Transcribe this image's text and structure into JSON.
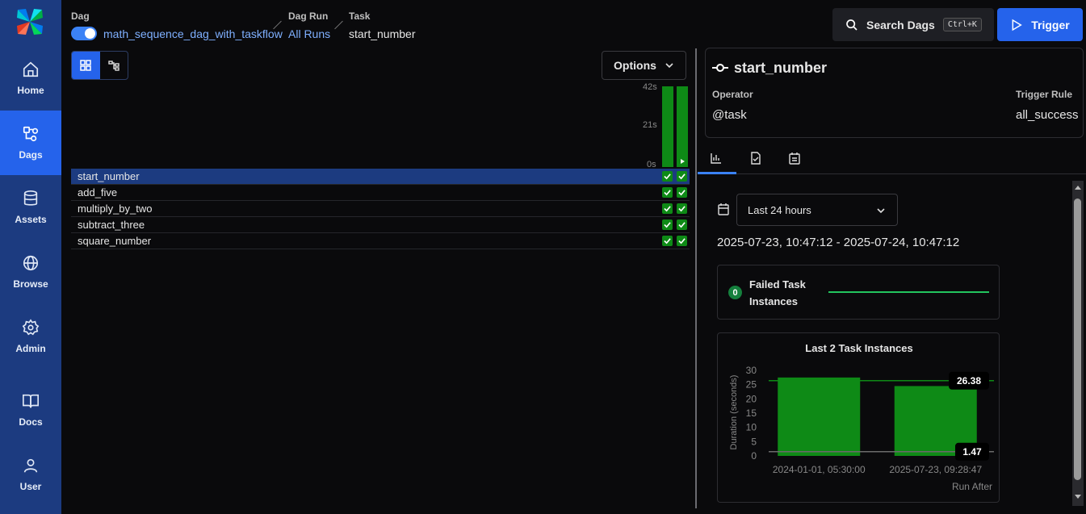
{
  "nav": [
    {
      "label": "Home",
      "icon": "home-icon"
    },
    {
      "label": "Dags",
      "icon": "dags-icon",
      "active": true
    },
    {
      "label": "Assets",
      "icon": "database-icon"
    },
    {
      "label": "Browse",
      "icon": "globe-icon"
    },
    {
      "label": "Admin",
      "icon": "gear-icon"
    },
    {
      "label": "Docs",
      "icon": "book-icon"
    },
    {
      "label": "User",
      "icon": "user-icon"
    }
  ],
  "breadcrumb": {
    "dag_label": "Dag",
    "dag_value": "math_sequence_dag_with_taskflow",
    "run_label": "Dag Run",
    "run_value": "All Runs",
    "task_label": "Task",
    "task_value": "start_number"
  },
  "header": {
    "search_label": "Search Dags",
    "search_shortcut": "Ctrl+K",
    "trigger_label": "Trigger"
  },
  "grid": {
    "options_label": "Options",
    "duration_ticks": [
      "42s",
      "21s",
      "0s"
    ],
    "run_durations_fraction": [
      1.0,
      1.0
    ],
    "tasks": [
      "start_number",
      "add_five",
      "multiply_by_two",
      "subtract_three",
      "square_number"
    ],
    "selected_task": "start_number",
    "status": "success",
    "status_color": "#0e8a16"
  },
  "task_detail": {
    "name": "start_number",
    "operator_label": "Operator",
    "operator_value": "@task",
    "trigger_rule_label": "Trigger Rule",
    "trigger_rule_value": "all_success",
    "tabs": [
      "chart-icon",
      "task-check-icon",
      "calendar-list-icon"
    ]
  },
  "stats": {
    "range_option": "Last 24 hours",
    "range_text": "2025-07-23, 10:47:12 - 2025-07-24, 10:47:12",
    "failed_count": "0",
    "failed_label_1": "Failed Task",
    "failed_label_2": "Instances",
    "accent_color": "#22c55e"
  },
  "chart_data": {
    "type": "bar",
    "title": "Last 2 Task Instances",
    "categories": [
      "2024-01-01, 05:30:00",
      "2025-07-23, 09:28:47"
    ],
    "series": [
      {
        "values": [
          27.5,
          24.5
        ]
      }
    ],
    "ylabel": "Duration (seconds)",
    "xlabel": "Run After",
    "yticks": [
      0,
      5,
      10,
      15,
      20,
      25,
      30
    ],
    "ylim": [
      0,
      30
    ],
    "reference_lines": [
      {
        "value": 26.38,
        "label": "26.38",
        "color": "#0e8a16"
      },
      {
        "value": 1.47,
        "label": "1.47",
        "color": "#6b6b6b"
      }
    ],
    "bar_color": "#0e8a16"
  }
}
